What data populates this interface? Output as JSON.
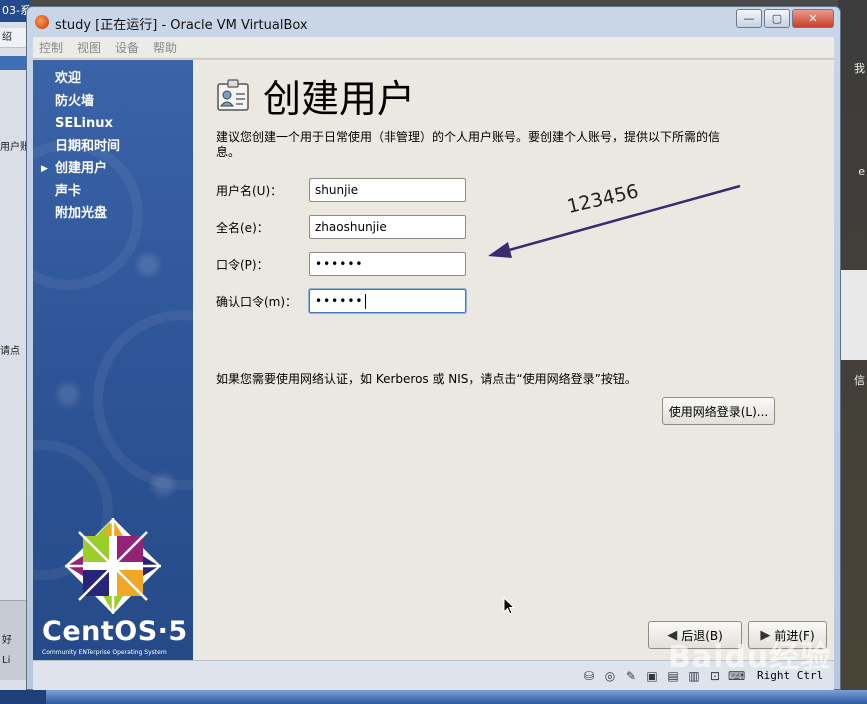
{
  "host": {
    "left_tab": "03-系",
    "left_bar": "绍",
    "left_text_1": "用户账",
    "left_text_2": "请点",
    "left_bottom_1": "好",
    "left_bottom_2": "Li",
    "right_text_1": "我",
    "right_text_2": "e",
    "right_text_3": "信"
  },
  "window": {
    "title": "study [正在运行] - Oracle VM VirtualBox",
    "minimize_label": "—",
    "restore_label": "▢",
    "close_label": "✕"
  },
  "menu": [
    "控制",
    "视图",
    "设备",
    "帮助"
  ],
  "sidebar": {
    "steps": [
      "欢迎",
      "防火墙",
      "SELinux",
      "日期和时间",
      "创建用户",
      "声卡",
      "附加光盘"
    ],
    "current_index": 4,
    "brand": "CentOS·5",
    "brand_sub": "Community ENTerprise Operating System"
  },
  "content": {
    "title": "创建用户",
    "description": "建议您创建一个用于日常使用（非管理）的个人用户账号。要创建个人账号，提供以下所需的信息。",
    "fields": [
      {
        "label": "用户名(U)：",
        "value": "shunjie"
      },
      {
        "label": "全名(e)：",
        "value": "zhaoshunjie"
      },
      {
        "label": "口令(P)：",
        "value": "••••••"
      },
      {
        "label": "确认口令(m)：",
        "value": "••••••"
      }
    ],
    "annotation": "123456",
    "network_note": "如果您需要使用网络认证，如 Kerberos 或 NIS，请点击“使用网络登录”按钮。",
    "network_button": "使用网络登录(L)...",
    "back_button": "后退(B)",
    "next_button": "前进(F)"
  },
  "statusbar": {
    "host_key": "Right Ctrl"
  },
  "watermark": "Baidu经验",
  "colors": {
    "sidebar_blue": "#2f5598",
    "guest_bg": "#ebe8e2",
    "arrow": "#3a2a6e"
  }
}
